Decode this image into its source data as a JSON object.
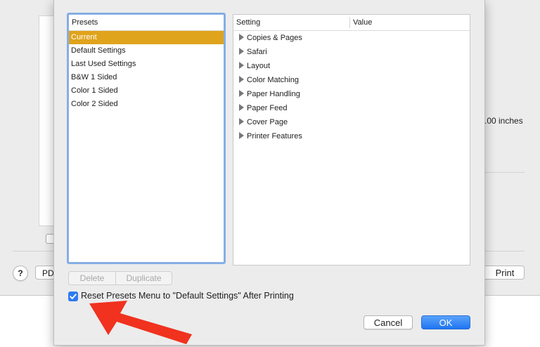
{
  "background": {
    "help_label": "?",
    "pdf_label": "PD",
    "print_label": "Print",
    "inches_text": ".00 inches"
  },
  "presets": {
    "header": "Presets",
    "items": [
      "Current",
      "Default Settings",
      "Last Used Settings",
      "B&W 1 Sided",
      "Color 1 Sided",
      "Color 2 Sided"
    ],
    "selected": "Current"
  },
  "settings": {
    "col_setting": "Setting",
    "col_value": "Value",
    "rows": [
      "Copies & Pages",
      "Safari",
      "Layout",
      "Color Matching",
      "Paper Handling",
      "Paper Feed",
      "Cover Page",
      "Printer Features"
    ]
  },
  "buttons": {
    "delete": "Delete",
    "duplicate": "Duplicate",
    "cancel": "Cancel",
    "ok": "OK"
  },
  "reset": {
    "checked": true,
    "label": "Reset Presets Menu to \"Default Settings\" After Printing"
  },
  "colors": {
    "selection": "#e0a31c",
    "accent": "#2d7bf2",
    "annotation_arrow": "#f0321e"
  },
  "icons": {
    "disclosure": "disclosure-triangle-icon",
    "check": "checkmark-icon",
    "annotation": "red-arrow"
  }
}
